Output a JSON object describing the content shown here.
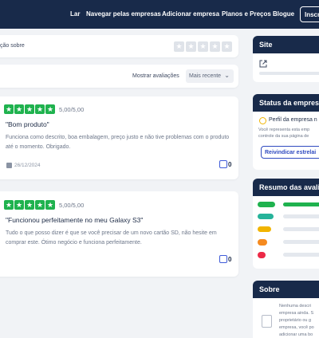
{
  "nav": {
    "links": [
      "Lar",
      "Navegar pelas empresas",
      "Adicionar empresa",
      "Planos e Preços",
      "Blogue"
    ],
    "button": "Inscre"
  },
  "rate": {
    "text": "ção sobre"
  },
  "sort": {
    "label": "Mostrar avaliações",
    "selected": "Mais recente"
  },
  "reviews": [
    {
      "rating": 5,
      "score": "5,00/5,00",
      "title": "\"Bom produto\"",
      "body": "Funciona como descrito, boa embalagem, preço justo e não tive problemas com o produto até o momento. Obrigado.",
      "date": "26/12/2024",
      "likes": "0"
    },
    {
      "rating": 5,
      "score": "5,00/5,00",
      "title": "\"Funcionou perfeitamente no meu Galaxy S3\"",
      "body": "Tudo o que posso dizer é que se você precisar de um novo cartão SD, não hesite em comprar este. Ótimo negócio e funciona perfeitamente.",
      "date": "26/12/2024",
      "likes": "0"
    }
  ],
  "side": {
    "site_title": "Site",
    "status_title": "Status da empres",
    "status_profile": "Perfil da empresa n",
    "status_desc_1": "Você representa esta emp",
    "status_desc_2": "controle da sua página de",
    "claim_button": "Reivindicar estrelai",
    "summary_title": "Resumo das avali",
    "about_title": "Sobre",
    "about_lines": [
      "Nenhuma descri",
      "empresa ainda. S",
      "proprietário ou g",
      "empresa, você po",
      "adicionar uma bo"
    ]
  },
  "summary": {
    "levels": [
      {
        "label": "5",
        "color": "#1fb24e",
        "share": 1.0
      },
      {
        "label": "4",
        "color": "#26b39a",
        "share": 0.0
      },
      {
        "label": "3",
        "color": "#f1b400",
        "share": 0.0
      },
      {
        "label": "2",
        "color": "#f58a1f",
        "share": 0.0
      },
      {
        "label": "1",
        "color": "#ec2a47",
        "share": 0.0
      }
    ]
  },
  "colors": {
    "nav": "#182a4a",
    "star_green": "#1fb24e",
    "accent_blue": "#2f4ac0"
  }
}
